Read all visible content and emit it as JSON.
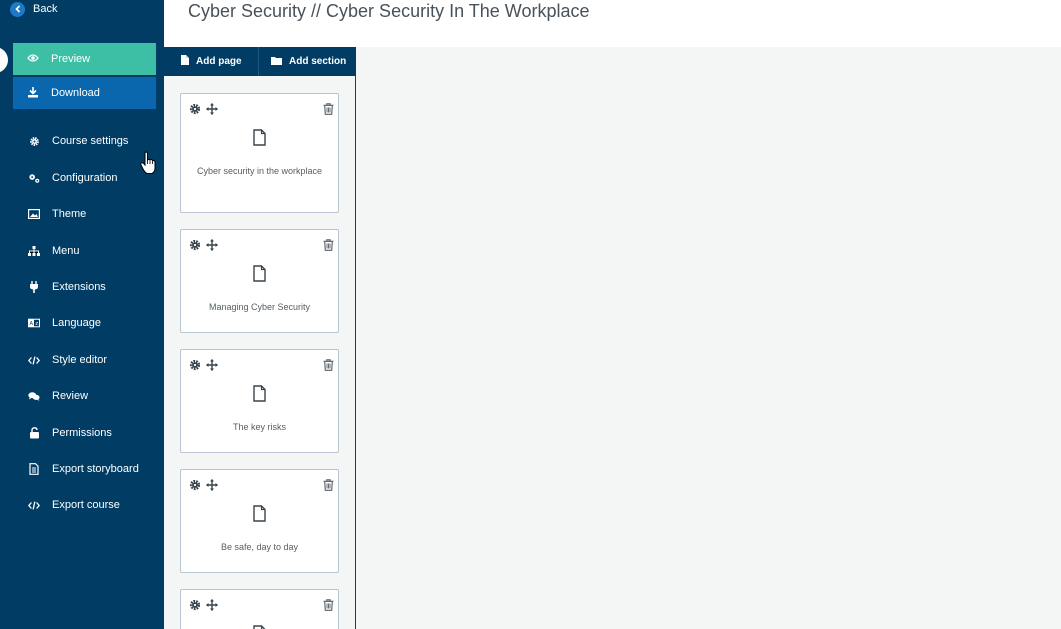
{
  "header": {
    "title": "Cyber Security // Cyber Security In The Workplace"
  },
  "sidebar": {
    "back_label": "Back",
    "preview_label": "Preview",
    "download_label": "Download",
    "items": [
      {
        "label": "Course settings",
        "icon": "gear-icon"
      },
      {
        "label": "Configuration",
        "icon": "gears-icon"
      },
      {
        "label": "Theme",
        "icon": "image-icon"
      },
      {
        "label": "Menu",
        "icon": "sitemap-icon"
      },
      {
        "label": "Extensions",
        "icon": "plug-icon"
      },
      {
        "label": "Language",
        "icon": "language-icon"
      },
      {
        "label": "Style editor",
        "icon": "code-icon"
      },
      {
        "label": "Review",
        "icon": "comments-icon"
      },
      {
        "label": "Permissions",
        "icon": "unlock-icon"
      },
      {
        "label": "Export storyboard",
        "icon": "file-text-icon"
      },
      {
        "label": "Export course",
        "icon": "code-icon"
      }
    ]
  },
  "pages_toolbar": {
    "add_page_label": "Add page",
    "add_section_label": "Add section"
  },
  "pages": [
    {
      "title": "Cyber security in the workplace"
    },
    {
      "title": "Managing Cyber Security"
    },
    {
      "title": "The key risks"
    },
    {
      "title": "Be safe, day to day"
    },
    {
      "title": ""
    }
  ],
  "colors": {
    "sidebar": "#003c64",
    "preview": "#3cbfa5",
    "download": "#0a67ad",
    "background": "#f4f5f5"
  }
}
